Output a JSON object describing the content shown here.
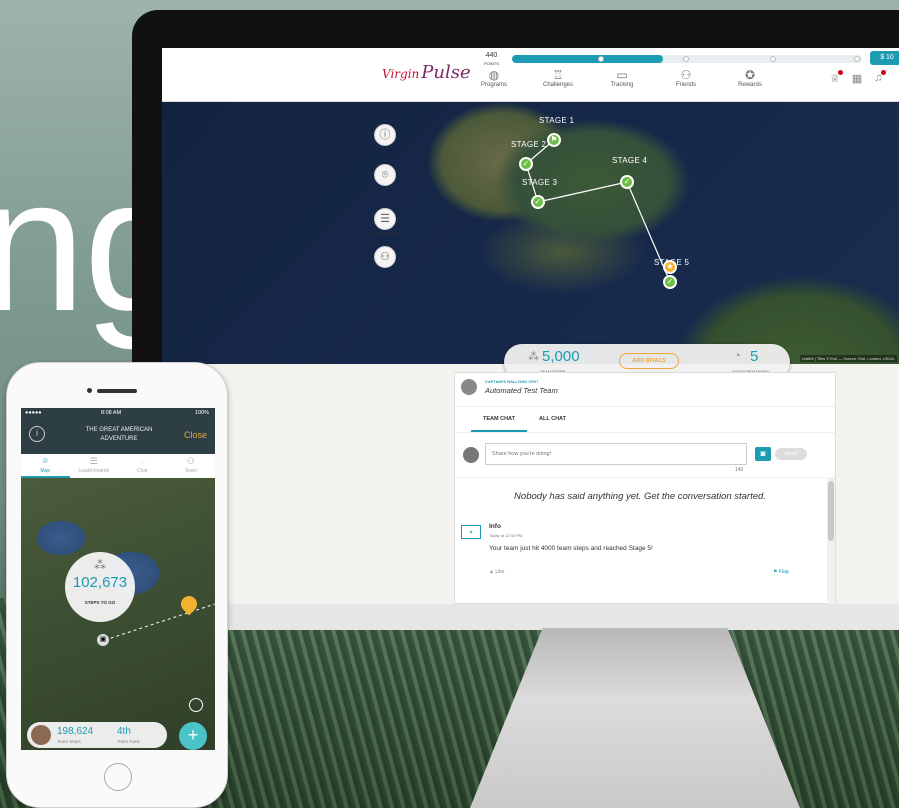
{
  "headline": "nges",
  "monitor": {
    "header": {
      "logo": "Pulse",
      "points_value": "440",
      "points_label": "POINTS",
      "cash_label": "$ 10",
      "progress_percent": 43,
      "nav": [
        {
          "label": "Programs",
          "icon": "globe-icon"
        },
        {
          "label": "Challenges",
          "icon": "trophy-icon"
        },
        {
          "label": "Tracking",
          "icon": "calendar-icon"
        },
        {
          "label": "Friends",
          "icon": "friends-icon"
        },
        {
          "label": "Rewards",
          "icon": "rewards-icon"
        }
      ]
    },
    "map": {
      "stages": [
        "STAGE 1",
        "STAGE 2",
        "STAGE 3",
        "STAGE 4",
        "STAGE 5"
      ],
      "side_buttons": {
        "challenge_map": "CHALLENGE MAP"
      },
      "team_steps_value": "5,000",
      "team_steps_label": "TEAM STEPS",
      "add_rivals": "ADD RIVALS",
      "days_value": "5",
      "days_label": "DAY(S) REMAINING",
      "attribution": "Leaflet | Tiles © Esri — Source: Esri, i-cubed, USDA,"
    },
    "chat": {
      "rallying_cry": "CAPTAIN'S RALLYING CRY!",
      "team_name": "Automated Test Team",
      "tabs": [
        "TEAM CHAT",
        "ALL CHAT"
      ],
      "input_placeholder": "Share how you're doing!",
      "send": "SEND",
      "char_count": "140",
      "empty_message": "Nobody has said anything yet. Get the conversation started.",
      "post": {
        "title": "Info",
        "date": "Today at 12:33 PM",
        "body": "Your team just hit 4000 team steps and reached Stage 5!",
        "like": "Like",
        "flag": "Flag"
      }
    }
  },
  "phone": {
    "status_time": "8:08 AM",
    "status_battery": "100%",
    "signal": "●●●●● ",
    "title": "THE GREAT AMERICAN ADVENTURE",
    "close": "Close",
    "tabs": [
      "Map",
      "Leaderboards",
      "Chat",
      "Team"
    ],
    "steps_to_go_value": "102,673",
    "steps_to_go_label": "STEPS TO GO",
    "team_steps_value": "198,624",
    "team_steps_label": "Team Steps",
    "team_rank_value": "4th",
    "team_rank_label": "Team Rank"
  },
  "colors": {
    "accent": "#1c9bb3",
    "stage": "#6cbe45",
    "star": "#f2b230",
    "rivals": "#f0a53a"
  }
}
